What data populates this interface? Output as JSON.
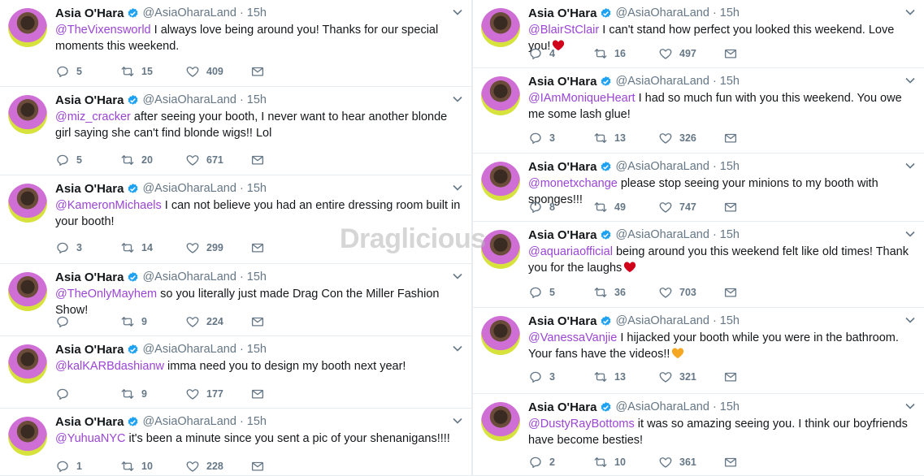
{
  "profile": {
    "name": "Asia O'Hara",
    "handle": "@AsiaOharaLand",
    "dot": "·",
    "time": "15h"
  },
  "watermark": "Draglicious",
  "colors": {
    "mention": "#9b45d4",
    "verified": "#1da1f2",
    "meta": "#657786"
  },
  "left_tweets": [
    {
      "mention": "@TheVixensworld",
      "text": " I always love being around you!   Thanks for our special moments this weekend.",
      "replies": "5",
      "retweets": "15",
      "likes": "409"
    },
    {
      "mention": "@miz_cracker",
      "text": " after seeing your booth, I never want to hear another blonde girl saying she can't find blonde wigs!!   Lol",
      "replies": "5",
      "retweets": "20",
      "likes": "671"
    },
    {
      "mention": "@KameronMichaels",
      "text": " I can not believe you had an entire dressing room built in your booth!",
      "replies": "3",
      "retweets": "14",
      "likes": "299"
    },
    {
      "mention": "@TheOnlyMayhem",
      "text": " so you literally just made Drag Con the Miller Fashion Show!",
      "replies": "",
      "retweets": "9",
      "likes": "224"
    },
    {
      "mention": "@kalKARBdashianw",
      "text": " imma need you to design my booth next year!",
      "replies": "",
      "retweets": "9",
      "likes": "177"
    },
    {
      "mention": "@YuhuaNYC",
      "text": " it's been a minute since you sent a pic of your shenanigans!!!!",
      "replies": "1",
      "retweets": "10",
      "likes": "228"
    }
  ],
  "right_tweets": [
    {
      "mention": "@BlairStClair",
      "text": " I can't stand how perfect you looked this weekend.    Love you!",
      "emoji": "red-heart-emoji",
      "replies": "4",
      "retweets": "16",
      "likes": "497"
    },
    {
      "mention": "@IAmMoniqueHeart",
      "text": " I had so much fun with you this weekend.  You owe me some lash glue!",
      "emoji": "",
      "replies": "3",
      "retweets": "13",
      "likes": "326"
    },
    {
      "mention": "@monetxchange",
      "text": " please stop seeing your minions to my booth with sponges!!!",
      "emoji": "",
      "replies": "8",
      "retweets": "49",
      "likes": "747"
    },
    {
      "mention": "@aquariaofficial",
      "text": " being around you this weekend felt like old times!   Thank you for the laughs",
      "emoji": "red-heart-emoji",
      "replies": "5",
      "retweets": "36",
      "likes": "703"
    },
    {
      "mention": "@VanessaVanjie",
      "text": " I hijacked your booth while you were in the bathroom. Your fans have the videos!!",
      "emoji": "orange-heart-emoji",
      "replies": "3",
      "retweets": "13",
      "likes": "321"
    },
    {
      "mention": "@DustyRayBottoms",
      "text": " it was so amazing seeing you.   I think our boyfriends have become besties!",
      "emoji": "",
      "replies": "2",
      "retweets": "10",
      "likes": "361"
    }
  ]
}
